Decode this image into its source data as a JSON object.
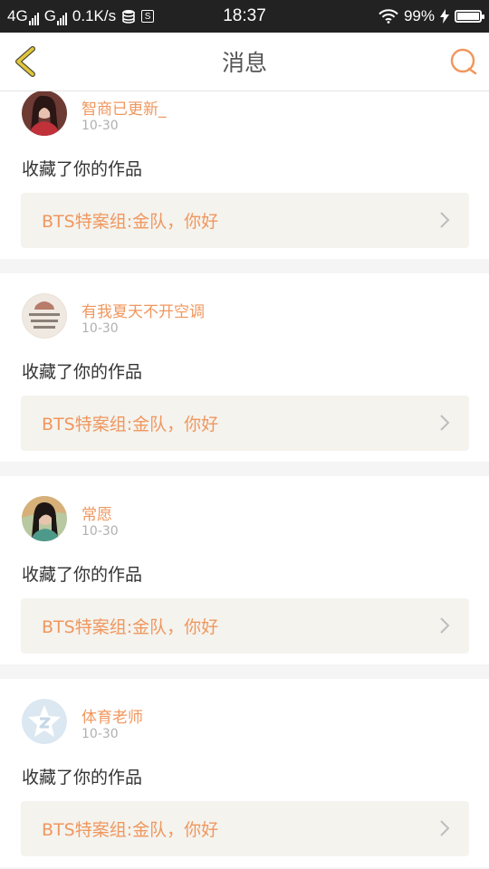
{
  "status_bar": {
    "network_1": "4G",
    "network_2": "G",
    "speed": "0.1K/s",
    "time": "18:37",
    "battery_percent": "99%",
    "battery_level": 0.99,
    "icons": [
      "signal-icon",
      "signal-icon",
      "data-icon",
      "s-app-icon",
      "wifi-icon",
      "charging-icon",
      "battery-icon"
    ]
  },
  "header": {
    "title": "消息",
    "back_icon": "chevron-left-icon",
    "search_icon": "search-icon",
    "accent_color": "#f0975e",
    "back_color": "#e2c63a"
  },
  "messages": [
    {
      "username": "智商已更新_",
      "time": "10-30",
      "action": "收藏了你的作品",
      "work_title": "BTS特案组:金队，你好"
    },
    {
      "username": "有我夏天不开空调",
      "time": "10-30",
      "action": "收藏了你的作品",
      "work_title": "BTS特案组:金队，你好"
    },
    {
      "username": "常愿",
      "time": "10-30",
      "action": "收藏了你的作品",
      "work_title": "BTS特案组:金队，你好"
    },
    {
      "username": "体育老师",
      "time": "10-30",
      "action": "收藏了你的作品",
      "work_title": "BTS特案组:金队，你好"
    }
  ]
}
